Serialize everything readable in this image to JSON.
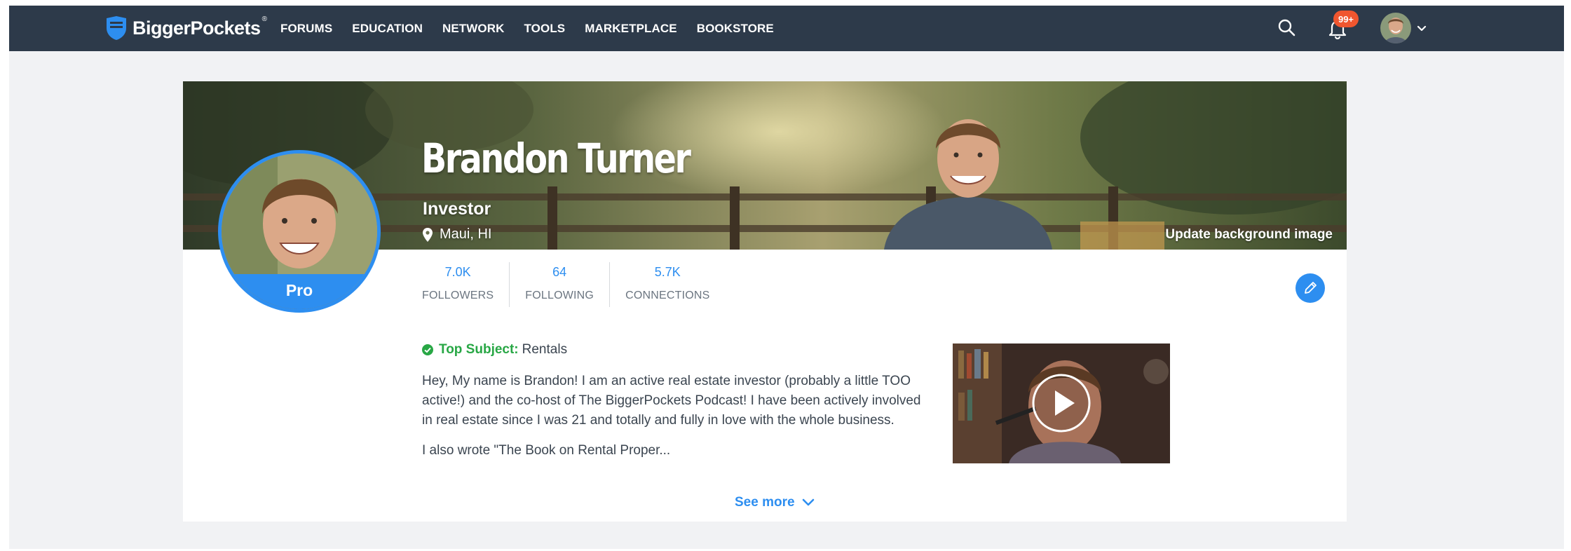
{
  "brand": {
    "name": "BiggerPockets",
    "reg": "®"
  },
  "nav": {
    "items": [
      {
        "label": "FORUMS"
      },
      {
        "label": "EDUCATION"
      },
      {
        "label": "NETWORK"
      },
      {
        "label": "TOOLS"
      },
      {
        "label": "MARKETPLACE"
      },
      {
        "label": "BOOKSTORE"
      }
    ],
    "notification_badge": "99+",
    "icons": [
      "search-icon",
      "bell-icon",
      "chevron-down-icon"
    ]
  },
  "profile": {
    "name": "Brandon Turner",
    "role": "Investor",
    "location": "Maui, HI",
    "badge": "Pro",
    "update_background": "Update background image",
    "stats": [
      {
        "value": "7.0K",
        "label": "FOLLOWERS"
      },
      {
        "value": "64",
        "label": "FOLLOWING"
      },
      {
        "value": "5.7K",
        "label": "CONNECTIONS"
      }
    ],
    "top_subject": {
      "label": "Top Subject:",
      "value": "Rentals"
    },
    "bio": "Hey, My name is Brandon! I am an active real estate investor (probably a little TOO active!) and the co-host of The BiggerPockets Podcast! I have been actively involved in real estate since I was 21 and totally and fully in love with the whole business.",
    "bio_more": "I also wrote \"The Book on Rental Proper...",
    "see_more": "See more"
  },
  "colors": {
    "nav_bg": "#2d3a4a",
    "accent_blue": "#2d8ef0",
    "badge_orange": "#f0562f",
    "subject_green": "#28a745",
    "page_bg": "#f1f2f4"
  }
}
